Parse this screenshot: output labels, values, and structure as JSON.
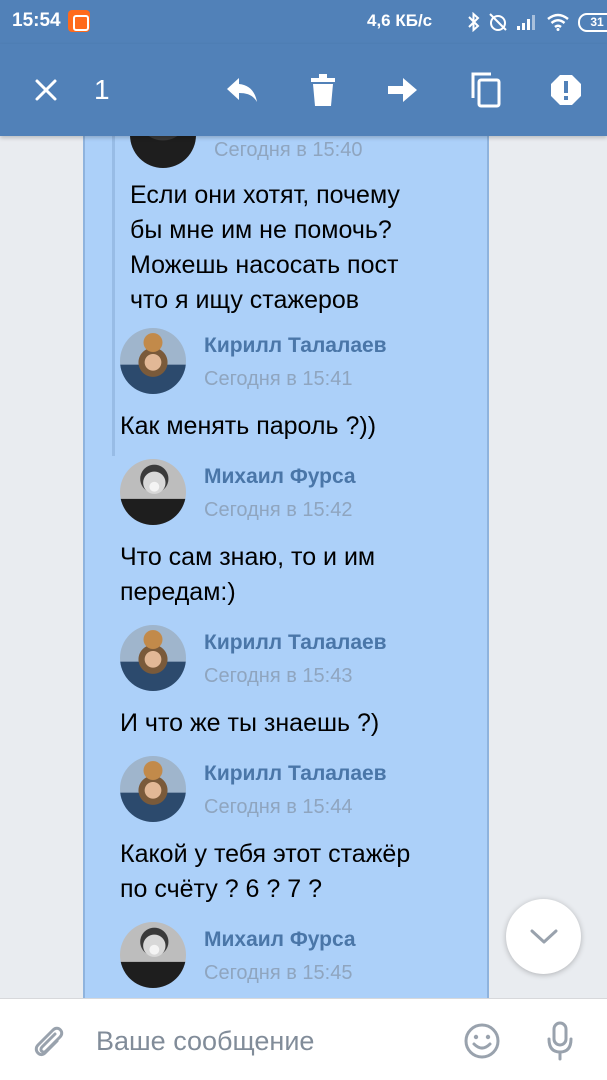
{
  "status_bar": {
    "time": "15:54",
    "network_speed": "4,6 КБ/с",
    "battery": "31"
  },
  "toolbar": {
    "selected_count": "1"
  },
  "messages": [
    {
      "author": "",
      "date": "Сегодня в 15:40",
      "lines": [
        "Если они хотят, почему",
        "бы мне им не помочь?",
        "Можешь насосать пост",
        "что я ищу стажеров"
      ]
    },
    {
      "author": "Кирилл Талалаев",
      "date": "Сегодня в 15:41",
      "lines": [
        "Как менять пароль ?))"
      ]
    },
    {
      "author": "Михаил Фурса",
      "date": "Сегодня в 15:42",
      "lines": [
        "Что сам знаю, то и им",
        "передам:)"
      ]
    },
    {
      "author": "Кирилл Талалаев",
      "date": "Сегодня в 15:43",
      "lines": [
        "И что же ты знаешь ?)"
      ]
    },
    {
      "author": "Кирилл Талалаев",
      "date": "Сегодня в 15:44",
      "lines": [
        "Какой у тебя этот стажёр",
        "по счёту ? 6 ? 7 ?"
      ]
    },
    {
      "author": "Михаил Фурса",
      "date": "Сегодня в 15:45",
      "lines": []
    }
  ],
  "composer": {
    "placeholder": "Ваше сообщение"
  },
  "colors": {
    "header": "#5181b8",
    "bubble": "#acd0f9",
    "author": "#4a76a8",
    "date": "#8fa5bf"
  },
  "icons": [
    "close-icon",
    "reply-icon",
    "trash-icon",
    "forward-icon",
    "copy-icon",
    "report-icon",
    "chevron-down-icon",
    "paperclip-icon",
    "smile-icon",
    "microphone-icon"
  ]
}
